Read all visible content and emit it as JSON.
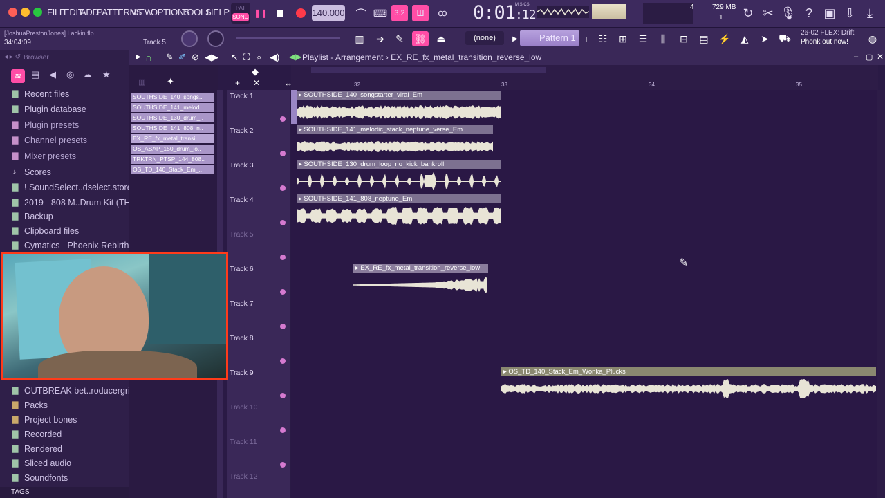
{
  "menu": [
    "FILE",
    "EDIT",
    "ADD",
    "PATTERNS",
    "VIEW",
    "OPTIONS",
    "TOOLS",
    "HELP"
  ],
  "mode": {
    "pat": "PAT",
    "song": "SONG"
  },
  "tempo": "140.000",
  "time": {
    "main": "0:01",
    "sub": "12",
    "label": "M:S:CS"
  },
  "meter": {
    "cpu": "4",
    "ram": "729 MB",
    "poly": "1"
  },
  "project": {
    "path": "[JoshuaPrestonJones] Lackin.flp",
    "time": "34:04:09",
    "track": "Track 5"
  },
  "pattern": {
    "none": "(none)",
    "name": "Pattern 1"
  },
  "hint": {
    "line1": "26-02  FLEX: Drift",
    "line2": "Phonk out now!"
  },
  "browser": {
    "title": "Browser",
    "items": [
      "Recent files",
      "Plugin database",
      "Plugin presets",
      "Channel presets",
      "Mixer presets",
      "Scores",
      "! SoundSelect..dselect.store)",
      "2019 - 808 M..Drum Kit (THP)",
      "Backup",
      "Clipboard files",
      "Cymatics - Phoenix Rebirth"
    ],
    "items_lower": [
      "OUTBREAK bet..roducergrind)",
      "Packs",
      "Project bones",
      "Recorded",
      "Rendered",
      "Sliced audio",
      "Soundfonts"
    ],
    "tags": "TAGS"
  },
  "playlist": {
    "title": "Playlist - Arrangement",
    "clip_name": "EX_RE_fx_metal_transition_reverse_low",
    "bars": [
      "32",
      "33",
      "34",
      "35"
    ],
    "picker": [
      "SOUTHSIDE_140_songs..",
      "SOUTHSIDE_141_melod..",
      "SOUTHSIDE_130_drum_..",
      "SOUTHSIDE_141_808_n..",
      "EX_RE_fx_metal_transi..",
      "OS_ASAP_150_drum_lo..",
      "TRKTRN_PTSP_144_808..",
      "OS_TD_140_Stack_Em_.."
    ],
    "tracks": [
      "Track 1",
      "Track 2",
      "Track 3",
      "Track 4",
      "Track 5",
      "Track 6",
      "Track 7",
      "Track 8",
      "Track 9",
      "Track 10",
      "Track 11",
      "Track 12"
    ],
    "clips": [
      {
        "name": "SOUTHSIDE_140_songstarter_viral_Em"
      },
      {
        "name": "SOUTHSIDE_141_melodic_stack_neptune_verse_Em"
      },
      {
        "name": "SOUTHSIDE_130_drum_loop_no_kick_bankroll"
      },
      {
        "name": "SOUTHSIDE_141_808_neptune_Em"
      },
      {
        "name": "EX_RE_fx_metal_transition_reverse_low"
      },
      {
        "name": "OS_TD_140_Stack_Em_Wonka_Plucks"
      }
    ]
  },
  "colors": {
    "accent": "#ff4da6",
    "clip_header": "#7d7190",
    "waveform": "#e8e4d6",
    "webcam_border": "#ff3b1a"
  }
}
